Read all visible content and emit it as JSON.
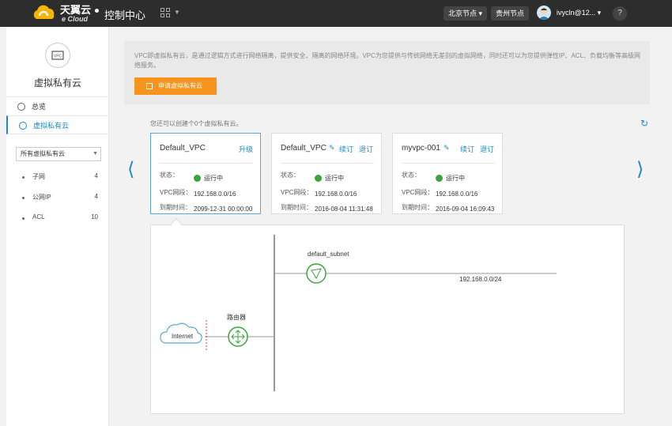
{
  "header": {
    "logo_cn": "天翼云",
    "logo_en": "e Cloud",
    "title": "控制中心",
    "region_selected": "北京节点",
    "region_other": "贵州节点",
    "username": "ivycln@12...",
    "help": "?"
  },
  "sidebar": {
    "icon_text": "VPC",
    "title": "虚拟私有云",
    "nav": [
      {
        "label": "总览"
      },
      {
        "label": "虚拟私有云"
      }
    ],
    "filter_value": "所有虚拟私有云",
    "stats": [
      {
        "label": "子网",
        "count": "4"
      },
      {
        "label": "公网IP",
        "count": "4"
      },
      {
        "label": "ACL",
        "count": "10"
      }
    ]
  },
  "banner": {
    "text": "VPC即虚拟私有云，是通过逻辑方式进行网络隔离，提供安全、隔离的网络环境。VPC为您提供与传统网络无差别的虚拟网络，同时还可以为您提供弹性IP、ACL、负载均衡等高级网络服务。",
    "apply_label": "申请虚拟私有云"
  },
  "hint": "您还可以创建个0个虚拟私有云。",
  "labels": {
    "status": "状态：",
    "segment": "VPC网段：",
    "expire": "到期时间："
  },
  "vpcs": [
    {
      "name": "Default_VPC",
      "actions": [
        "升级"
      ],
      "status": "运行中",
      "segment": "192.168.0.0/16",
      "expire": "2099-12-31 00:00:00"
    },
    {
      "name": "Default_VPC",
      "actions": [
        "续订",
        "退订"
      ],
      "status": "运行中",
      "segment": "192.168.0.0/16",
      "expire": "2016-08-04 11:31:48"
    },
    {
      "name": "myvpc-001",
      "actions": [
        "续订",
        "退订"
      ],
      "status": "运行中",
      "segment": "192.168.0.0/16",
      "expire": "2016-09-04 16:09:43"
    }
  ],
  "topology": {
    "subnet_name": "default_subnet",
    "subnet_cidr": "192.168.0.0/24",
    "router_label": "路由器",
    "internet_label": "Internet"
  },
  "colors": {
    "accent": "#1e88c7",
    "orange": "#f7941d",
    "green": "#3aa53a"
  }
}
